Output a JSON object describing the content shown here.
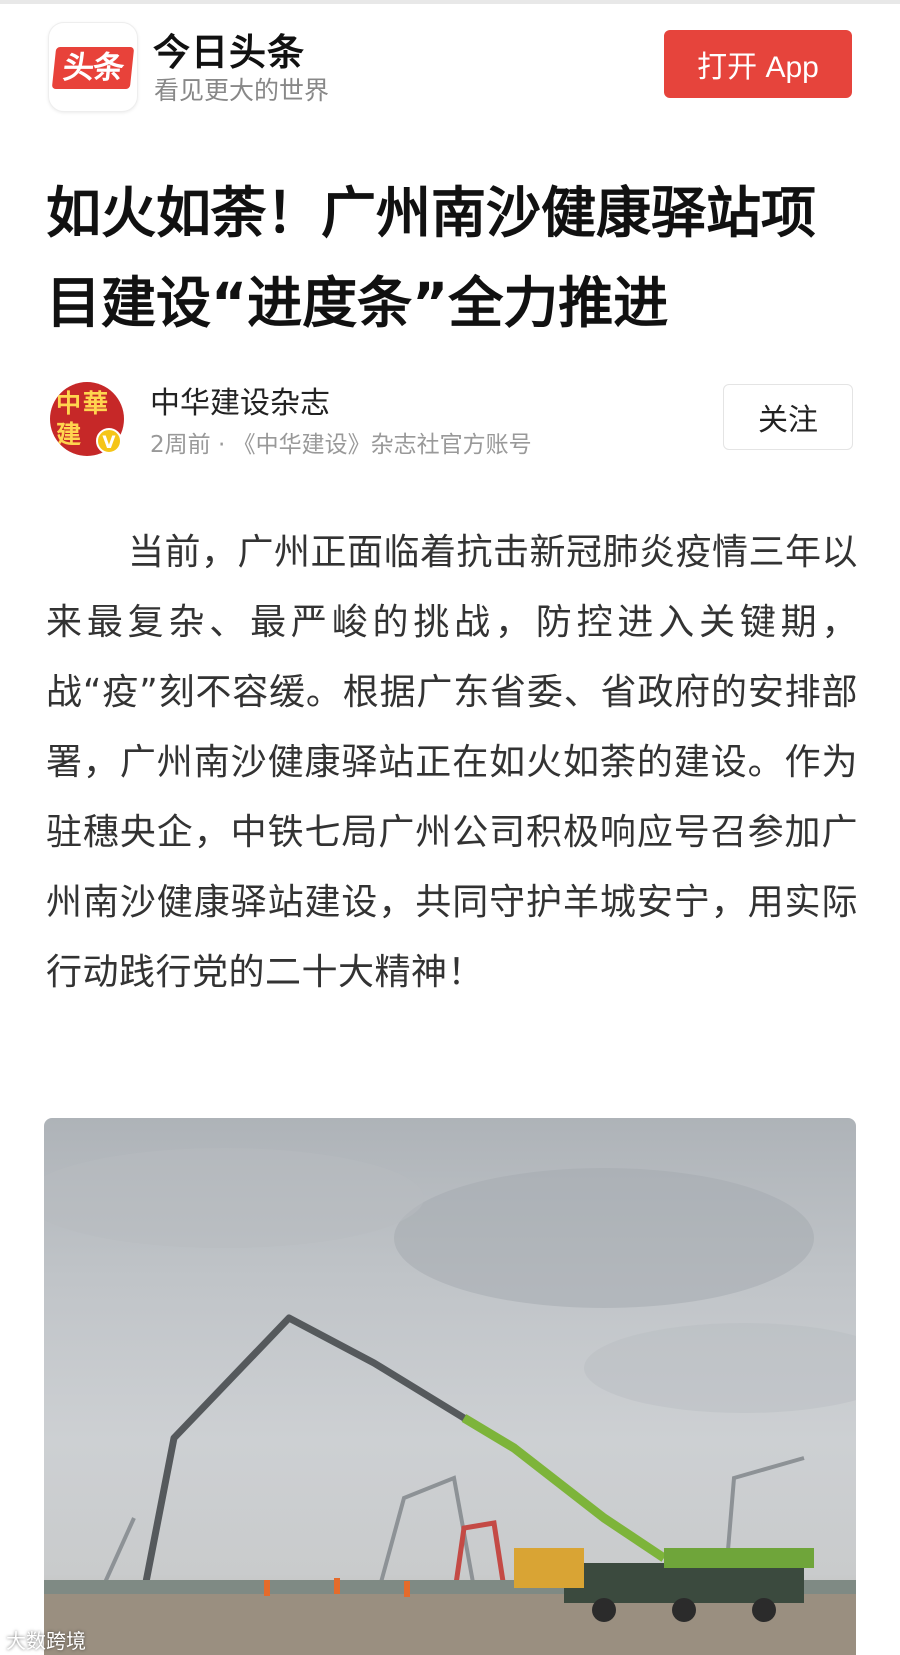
{
  "header": {
    "logo_text": "头条",
    "app_name": "今日头条",
    "slogan": "看见更大的世界",
    "open_app_label": "打开 App"
  },
  "article": {
    "title": "如火如荼！广州南沙健康驿站项目建设“进度条”全力推进",
    "author": {
      "avatar_text": "中華建",
      "verified_mark": "V",
      "name": "中华建设杂志",
      "meta": "2周前 · 《中华建设》杂志社官方账号",
      "follow_label": "关注"
    },
    "body": "当前，广州正面临着抗击新冠肺炎疫情三年以来最复杂、最严峻的挑战，防控进入关键期，战“疫”刻不容缓。根据广东省委、省政府的安排部署，广州南沙健康驿站正在如火如荼的建设。作为驻穗央企，中铁七局广州公司积极响应号召参加广州南沙健康驿站建设，共同守护羊城安宁，用实际行动践行党的二十大精神！"
  },
  "photo": {
    "watermark": "大数跨境"
  }
}
